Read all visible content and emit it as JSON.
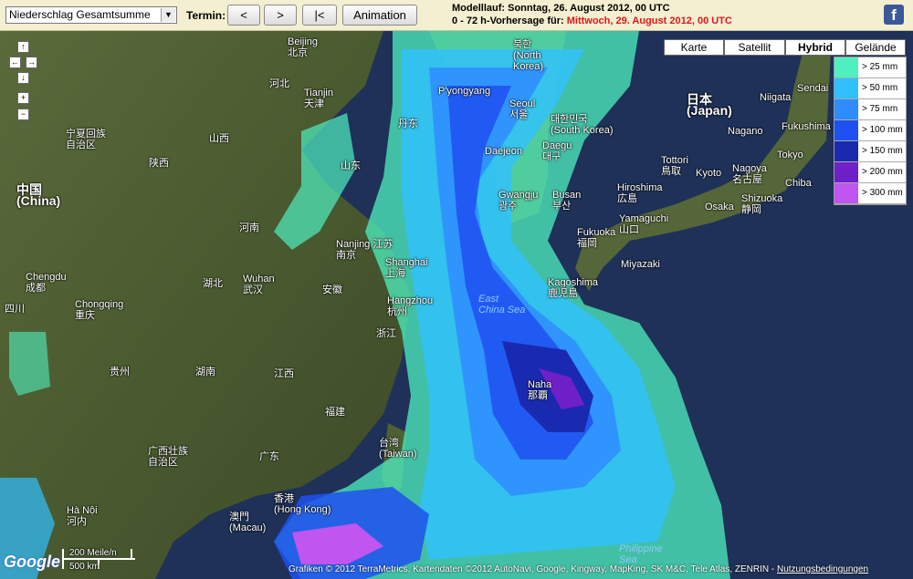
{
  "toolbar": {
    "product_select": "Niederschlag Gesamtsumme",
    "termin_label": "Termin:",
    "prev_label": "<",
    "next_label": ">",
    "first_label": "|<",
    "animation_label": "Animation",
    "modelllauf": "Modelllauf: Sonntag, 26. August 2012, 00 UTC",
    "forecast_prefix": "0 - 72 h-Vorhersage für: ",
    "forecast_time": "Mittwoch, 29. August 2012, 00 UTC",
    "facebook_glyph": "f"
  },
  "map_types": [
    "Karte",
    "Satellit",
    "Hybrid",
    "Gelände"
  ],
  "active_map_type": "Hybrid",
  "zoom": {
    "in": "+",
    "out": "−"
  },
  "legend": [
    {
      "label": "> 25 mm",
      "color": "#4ff0c0"
    },
    {
      "label": "> 50 mm",
      "color": "#2fc0ff"
    },
    {
      "label": "> 75 mm",
      "color": "#2f8cff"
    },
    {
      "label": "> 100 mm",
      "color": "#1f50f0"
    },
    {
      "label": "> 150 mm",
      "color": "#1a2ab0"
    },
    {
      "label": "> 200 mm",
      "color": "#7020c8"
    },
    {
      "label": "> 300 mm",
      "color": "#c055f0"
    }
  ],
  "places": {
    "beijing": "Beijing\n北京",
    "tianjin": "Tianjin\n天津",
    "hebei": "河北",
    "ningxia": "宁夏回族\n自治区",
    "shanxi": "山西",
    "shaanxi": "陕西",
    "china": "中国\n(China)",
    "henan": "河南",
    "shandong": "山东",
    "nanjing": "Nanjing 江苏\n南京",
    "shanghai": "Shanghai\n上海",
    "hangzhou": "Hangzhou\n杭州",
    "anhui": "安徽",
    "zhejiang": "浙江",
    "chengdu": "Chengdu\n成都",
    "chongqing": "Chongqing\n重庆",
    "sichuan": "四川",
    "hubei": "湖北",
    "wuhan": "Wuhan\n武汉",
    "hunan": "湖南",
    "jiangxi": "江西",
    "guizhou": "贵州",
    "fujian": "福建",
    "guangxi": "广西壮族\n自治区",
    "guangdong": "广东",
    "macau": "澳門\n(Macau)",
    "hongkong": "香港\n(Hong Kong)",
    "hanoi": "Hà Nội\n河内",
    "taiwan": "台湾\n(Taiwan)",
    "pyongyang": "P'yongyang",
    "northkorea": "북한\n(North\nKorea)",
    "seoul": "Seoul\n서울",
    "daejeon": "Daejeon",
    "daegu": "Daegu\n대구",
    "southkorea": "대한민국\n(South Korea)",
    "gwangju": "Gwangju\n광주",
    "busan": "Busan\n부산",
    "japan": "日本\n(Japan)",
    "niigata": "Niigata",
    "sendai": "Sendai",
    "fukushima": "Fukushima",
    "nagano": "Nagano",
    "tokyo": "Tokyo",
    "chiba": "Chiba",
    "tottori": "Tottori\n鳥取",
    "kyoto": "Kyoto",
    "nagoya": "Nagoya\n名古屋",
    "hiroshima": "Hiroshima\n広島",
    "osaka": "Osaka",
    "shizuoka": "Shizuoka\n静岡",
    "yamaguchi": "Yamaguchi\n山口",
    "fukuoka": "Fukuoka\n福岡",
    "miyazaki": "Miyazaki",
    "kagoshima": "Kagoshima\n鹿児島",
    "eastchinasea": "East\nChina Sea",
    "naha": "Naha\n那覇",
    "philippinesea": "Philippine\nSea",
    "dandong": "丹东"
  },
  "scale": {
    "miles": "200 Meile/n",
    "km": "500 km"
  },
  "copyright": "Grafiken © 2012 TerraMetrics, Kartendaten ©2012 AutoNavi, Google, Kingway, MapKing, SK M&C, Tele Atlas, ZENRIN - ",
  "terms_link": "Nutzungsbedingungen",
  "google_logo": "Google"
}
